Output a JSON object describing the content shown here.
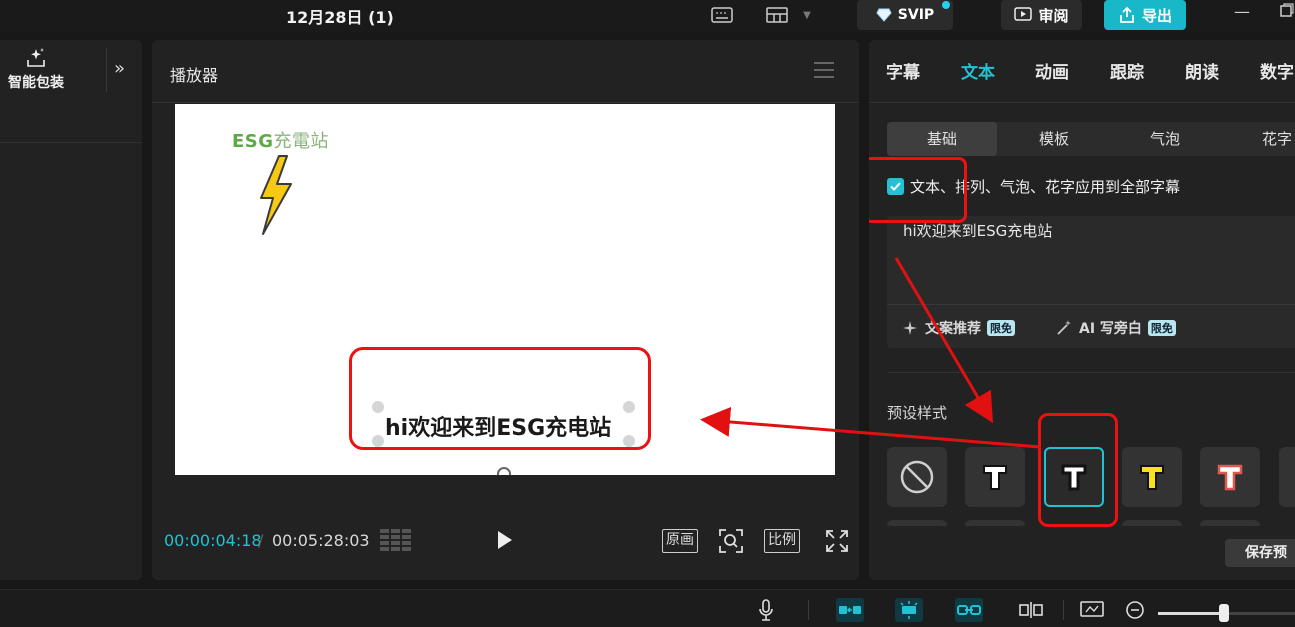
{
  "topbar": {
    "project_title": "12月28日 (1)",
    "svip_label": "SVIP",
    "review_label": "审阅",
    "export_label": "导出",
    "icons": [
      "keyboard-icon",
      "layout-icon",
      "diamond-icon",
      "review-icon",
      "export-icon",
      "minimize-icon",
      "maximize-icon"
    ]
  },
  "left_panel": {
    "smart_pack_label": "智能包装"
  },
  "player": {
    "title": "播放器",
    "canvas": {
      "logo_latin": "ESG",
      "logo_cjk": "充電站",
      "caption": "hi欢迎来到ESG充电站"
    },
    "current_time": "00:00:04:18",
    "time_separator": "/",
    "total_time": "00:05:28:03",
    "buttons": {
      "original": "原画",
      "ratio": "比例"
    }
  },
  "right_panel": {
    "tabs": [
      {
        "label": "字幕",
        "active": false
      },
      {
        "label": "文本",
        "active": true
      },
      {
        "label": "动画",
        "active": false
      },
      {
        "label": "跟踪",
        "active": false
      },
      {
        "label": "朗读",
        "active": false
      },
      {
        "label": "数字",
        "active": false
      }
    ],
    "subtabs": [
      {
        "label": "基础",
        "active": true
      },
      {
        "label": "模板",
        "active": false
      },
      {
        "label": "气泡",
        "active": false
      },
      {
        "label": "花字",
        "active": false
      }
    ],
    "apply_all_label": "文本、排列、气泡、花字应用到全部字幕",
    "apply_all_checked": true,
    "text_value": "hi欢迎来到ESG充电站",
    "actions": [
      {
        "label": "文案推荐",
        "badge": "限免"
      },
      {
        "label": "AI 写旁白",
        "badge": "限免"
      }
    ],
    "preset_label": "预设样式",
    "save_preset_label": "保存预",
    "accent": "#22c1d3"
  },
  "bottom_toolbar": {
    "icons": [
      "microphone-icon",
      "link-main-track-icon",
      "magnet-icon",
      "link-icon",
      "split-icon",
      "preview-axis-icon",
      "zoom-out-icon"
    ],
    "zoom_level": 0.45
  },
  "annotation_color": "#e11111"
}
